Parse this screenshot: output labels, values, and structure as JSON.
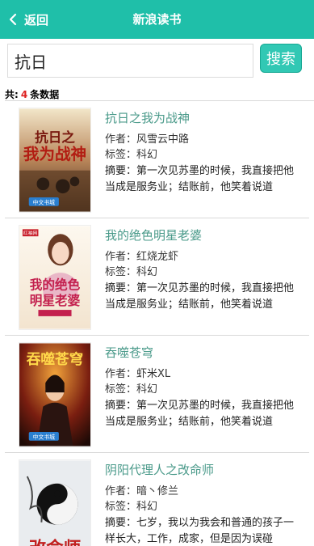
{
  "header": {
    "back_label": "返回",
    "title": "新浪读书",
    "accent_color": "#1fbfa9"
  },
  "search": {
    "value": "抗日",
    "button_label": "搜索"
  },
  "results": {
    "prefix": "共:",
    "count": "4",
    "suffix": "条数据"
  },
  "labels": {
    "author": "作者：",
    "tag": "标签：",
    "summary": "摘要："
  },
  "books": [
    {
      "title": "抗日之我为战神",
      "author": "风雪云中路",
      "tag": "科幻",
      "summary": "第一次见苏墨的时候，我直接把他当成是服务业；结账前，他笑着说道",
      "cover_text": "抗日之我为战神",
      "cover_badge": "中文书城",
      "cover_icon": "war-scene-cover"
    },
    {
      "title": "我的绝色明星老婆",
      "author": "红烧龙虾",
      "tag": "科幻",
      "summary": "第一次见苏墨的时候，我直接把他当成是服务业；结账前，他笑着说道",
      "cover_text": "我的绝色明星老婆",
      "cover_badge": "红袖网",
      "cover_icon": "portrait-cover"
    },
    {
      "title": "吞噬苍穹",
      "author": "虾米XL",
      "tag": "科幻",
      "summary": "第一次见苏墨的时候，我直接把他当成是服务业；结账前，他笑着说道",
      "cover_text": "吞噬苍穹",
      "cover_badge": "中文书城",
      "cover_icon": "warrior-cover"
    },
    {
      "title": "阴阳代理人之改命师",
      "author": "暗丶修兰",
      "tag": "科幻",
      "summary": "七岁，我以为我会和普通的孩子一样长大，工作，成家，但是因为误碰",
      "cover_text": "改命师",
      "cover_badge": "",
      "cover_icon": "yin-yang-cover"
    }
  ]
}
